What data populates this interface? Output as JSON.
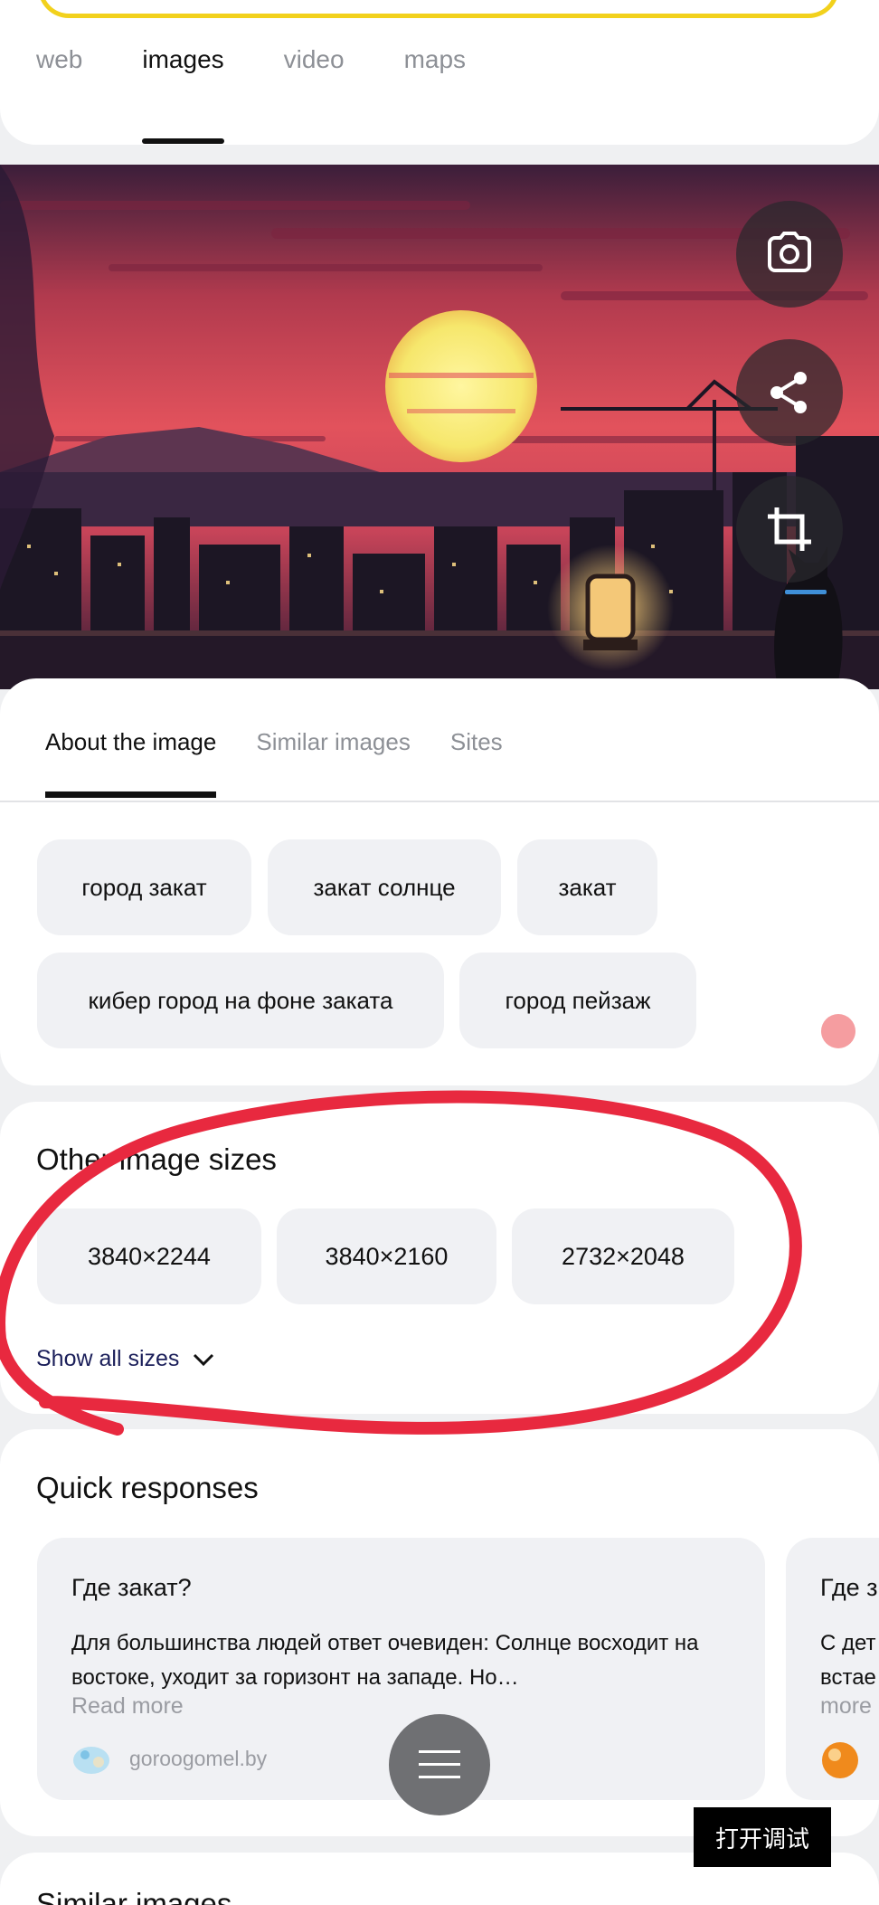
{
  "top_tabs": [
    {
      "label": "web"
    },
    {
      "label": "images"
    },
    {
      "label": "video"
    },
    {
      "label": "maps"
    }
  ],
  "image_tabs": [
    {
      "label": "About the image"
    },
    {
      "label": "Similar images"
    },
    {
      "label": "Sites"
    }
  ],
  "tags": [
    "город закат",
    "закат солнце",
    "закат",
    "кибер город на фоне заката",
    "город пейзаж"
  ],
  "sizes": {
    "title": "Other image sizes",
    "items": [
      "3840×2244",
      "3840×2160",
      "2732×2048"
    ],
    "show_all": "Show all sizes"
  },
  "quick": {
    "title": "Quick responses",
    "cards": [
      {
        "question": "Где закат?",
        "text": "Для большинства людей ответ очевиден: Солнце восходит на востоке, уходит за горизонт на западе. Но…",
        "more": "Read more",
        "source": "goroogomel.by"
      },
      {
        "question": "Где з",
        "text": "С дет встае",
        "more": "more",
        "source": ""
      }
    ]
  },
  "debug_button": "打开调试",
  "similar_title": "Similar images",
  "colors": {
    "accent_yellow": "#f2d11c",
    "annotation_red": "#e8293f",
    "chip_bg": "#f0f1f4"
  },
  "icons": {
    "camera": "camera-icon",
    "share": "share-icon",
    "crop": "crop-icon",
    "menu": "hamburger-menu-icon",
    "chevron": "chevron-down-icon"
  }
}
